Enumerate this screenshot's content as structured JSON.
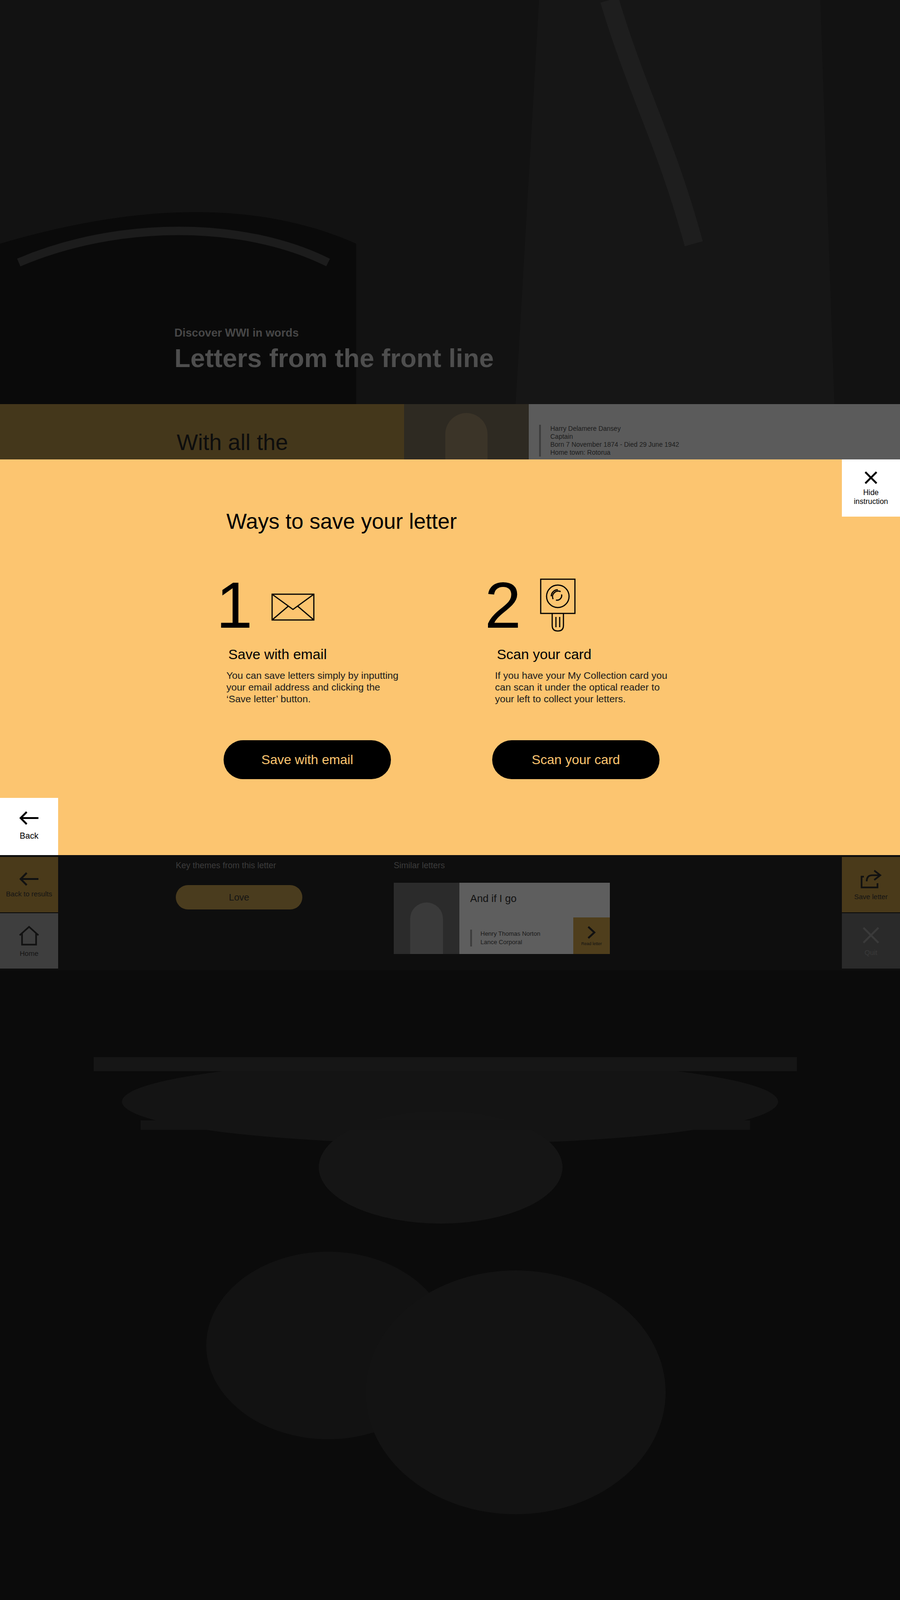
{
  "hero": {
    "kicker": "Discover WWI in words",
    "title": "Letters from the front line"
  },
  "letter": {
    "title": "With all the",
    "author_lines": [
      "Harry Delamere Dansey",
      "Captain",
      "Born 7 November 1874 - Died 29 June 1942",
      "Home town: Rotorua"
    ]
  },
  "modal": {
    "hide_label": "Hide instruction",
    "title": "Ways to save your letter",
    "options": [
      {
        "number": "1",
        "title": "Save with email",
        "description": "You can save letters simply by inputting your email address and clicking the ‘Save letter’ button.",
        "button": "Save with email"
      },
      {
        "number": "2",
        "title": "Scan your card",
        "description": "If you have your My Collection card you can scan it under the optical reader to your left to collect your letters.",
        "button": "Scan your card"
      }
    ]
  },
  "nav": {
    "back": "Back",
    "left": [
      {
        "label": "Back to results"
      },
      {
        "label": "Home"
      }
    ],
    "right": [
      {
        "label": "Save letter",
        "disabled": false
      },
      {
        "label": "Quit",
        "disabled": true
      }
    ]
  },
  "themes": {
    "heading": "Key themes from this letter",
    "tags": [
      "Love"
    ]
  },
  "similar": {
    "heading": "Similar letters",
    "cards": [
      {
        "title": "And if I go",
        "name": "Henry Thomas Norton",
        "rank": "Lance Corporal",
        "action": "Read letter"
      }
    ]
  }
}
